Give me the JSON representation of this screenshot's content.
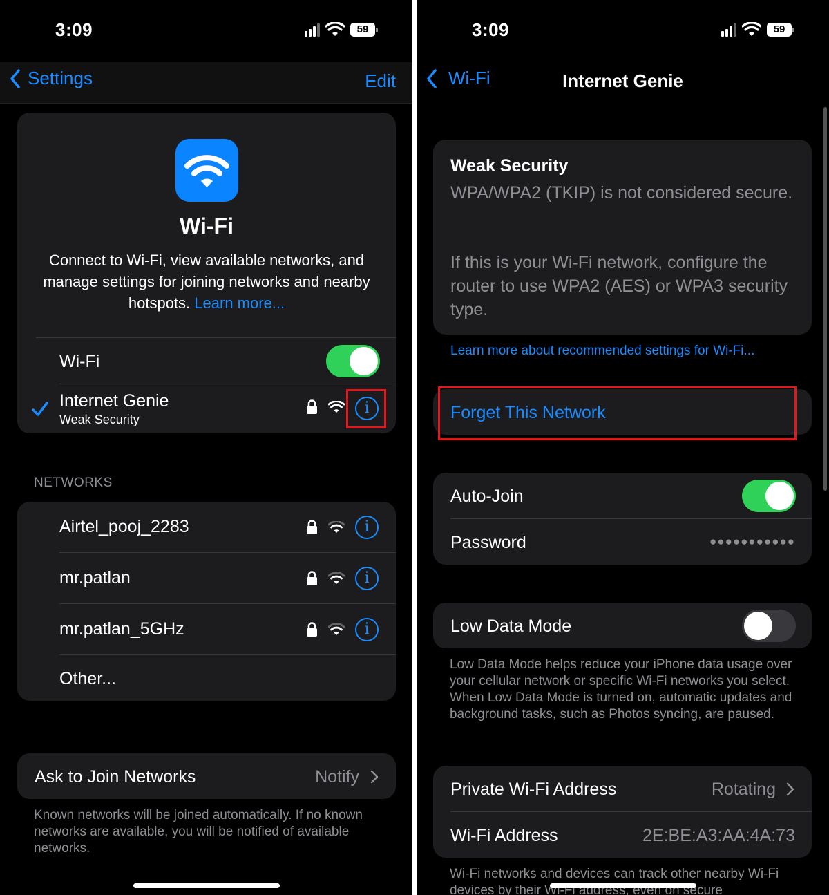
{
  "left": {
    "status": {
      "time": "3:09",
      "battery": "59"
    },
    "nav": {
      "back_label": "Settings",
      "edit_label": "Edit"
    },
    "header_card": {
      "title": "Wi-Fi",
      "description": "Connect to Wi-Fi, view available networks, and manage settings for joining networks and nearby hotspots.",
      "learn_more": "Learn more..."
    },
    "wifi_toggle_label": "Wi-Fi",
    "wifi_toggle_on": true,
    "connected": {
      "name": "Internet Genie",
      "subtitle": "Weak Security"
    },
    "networks_header": "NETWORKS",
    "networks": [
      {
        "name": "Airtel_pooj_2283"
      },
      {
        "name": "mr.patlan"
      },
      {
        "name": "mr.patlan_5GHz"
      }
    ],
    "other_label": "Other...",
    "ask_to_join": {
      "label": "Ask to Join Networks",
      "value": "Notify"
    },
    "ask_footnote": "Known networks will be joined automatically. If no known networks are available, you will be notified of available networks."
  },
  "right": {
    "status": {
      "time": "3:09",
      "battery": "59"
    },
    "nav": {
      "back_label": "Wi-Fi",
      "title": "Internet Genie"
    },
    "weak_security": {
      "title": "Weak Security",
      "line1": "WPA/WPA2 (TKIP) is not considered secure.",
      "line2": "If this is your Wi-Fi network, configure the router to use WPA2 (AES) or WPA3 security type."
    },
    "learn_more_link": "Learn more about recommended settings for Wi-Fi...",
    "forget_label": "Forget This Network",
    "auto_join": {
      "label": "Auto-Join",
      "on": true
    },
    "password": {
      "label": "Password",
      "value": "●●●●●●●●●●●"
    },
    "low_data": {
      "label": "Low Data Mode",
      "on": false
    },
    "low_data_footnote": "Low Data Mode helps reduce your iPhone data usage over your cellular network or specific Wi-Fi networks you select. When Low Data Mode is turned on, automatic updates and background tasks, such as Photos syncing, are paused.",
    "private_address": {
      "label": "Private Wi-Fi Address",
      "value": "Rotating"
    },
    "wifi_address": {
      "label": "Wi-Fi Address",
      "value": "2E:BE:A3:AA:4A:73"
    },
    "address_footnote": "Wi-Fi networks and devices can track other nearby Wi-Fi devices by their Wi-Fi address, even on secure"
  },
  "colors": {
    "accent": "#1a8cff",
    "toggle_on": "#30d158",
    "highlight": "#e3161c",
    "card": "#1c1c1e"
  }
}
